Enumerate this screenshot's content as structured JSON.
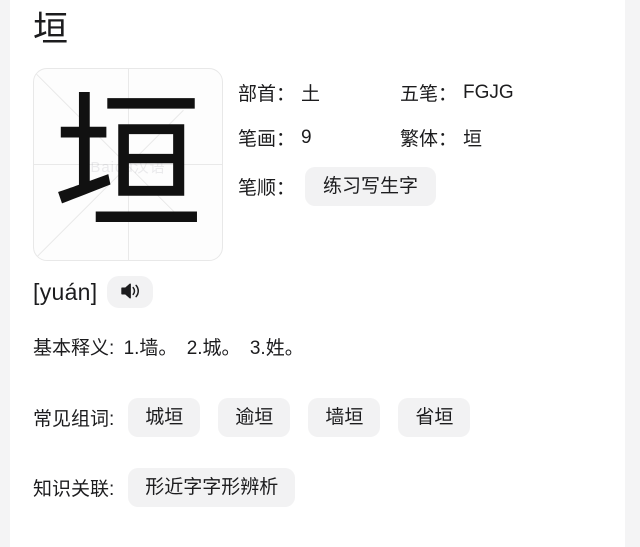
{
  "page": {
    "title": "垣"
  },
  "char_card": {
    "glyph": "垣",
    "watermark": "Baidu汉语"
  },
  "info": {
    "rows": [
      {
        "left": {
          "label": "部首：",
          "value": "土"
        },
        "right": {
          "label": "五笔：",
          "value": "FGJG"
        }
      },
      {
        "left": {
          "label": "笔画：",
          "value": "9"
        },
        "right": {
          "label": "繁体：",
          "value": "垣"
        }
      }
    ],
    "stroke_order": {
      "label": "笔顺：",
      "button": "练习写生字"
    }
  },
  "pinyin": {
    "text": "[yuán]",
    "audio_icon": "speaker-icon"
  },
  "definition": {
    "label": "基本释义:",
    "senses": [
      "1.墙。",
      "2.城。",
      "3.姓。"
    ]
  },
  "words": {
    "label": "常见组词:",
    "items": [
      "城垣",
      "逾垣",
      "墙垣",
      "省垣"
    ]
  },
  "knowledge": {
    "label": "知识关联:",
    "items": [
      "形近字字形辨析"
    ]
  },
  "colors": {
    "background": "#ffffff",
    "page_edge": "#f4f4f5",
    "chip_background": "#f2f2f3",
    "text": "#1c1c1e",
    "grid_line": "#e9e9e9"
  }
}
